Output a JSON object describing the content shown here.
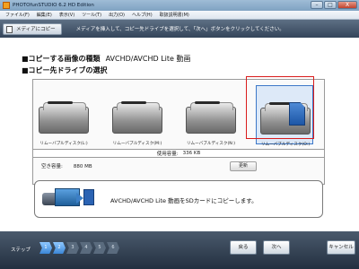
{
  "window": {
    "title": "PHOTOfunSTUDIO 6.2 HD Edition",
    "buttons": {
      "minimize": "–",
      "maximize": "□",
      "close": "X"
    }
  },
  "menu": {
    "items": [
      "ファイル(F)",
      "編集(E)",
      "表示(V)",
      "ツール(T)",
      "出力(O)",
      "ヘルプ(H)",
      "取扱説明書(M)"
    ]
  },
  "info": {
    "step_badge": "メディアにコピー",
    "instruction": "メディアを挿入して、コピー先ドライブを選択して、「次へ」ボタンをクリックしてください。"
  },
  "content": {
    "copy_type_label": "■コピーする画像の種類",
    "copy_type_value": "AVCHD/AVCHD Lite 動画",
    "drive_select_label": "■コピー先ドライブの選択",
    "drives": [
      {
        "label": "リムーバブルディスク(L:)"
      },
      {
        "label": "リムーバブルディスク(M:)"
      },
      {
        "label": "リムーバブルディスク(N:)"
      },
      {
        "label": "リムーバブルディスク(O:)"
      }
    ],
    "used_label": "使用容量:",
    "used_value": "336 KB",
    "free_label": "空き容量:",
    "free_value": "880 MB",
    "update_button": "更新",
    "message": "AVCHD/AVCHD Lite 動画をSDカードにコピーします。"
  },
  "bottom": {
    "step_label": "ステップ",
    "steps": [
      "1",
      "2",
      "3",
      "4",
      "5",
      "6"
    ],
    "back_button": "戻る",
    "next_button": "次へ",
    "cancel_button": "キャンセル"
  },
  "colors": {
    "selection_border": "#d91c1c",
    "accent": "#3b86d6"
  }
}
